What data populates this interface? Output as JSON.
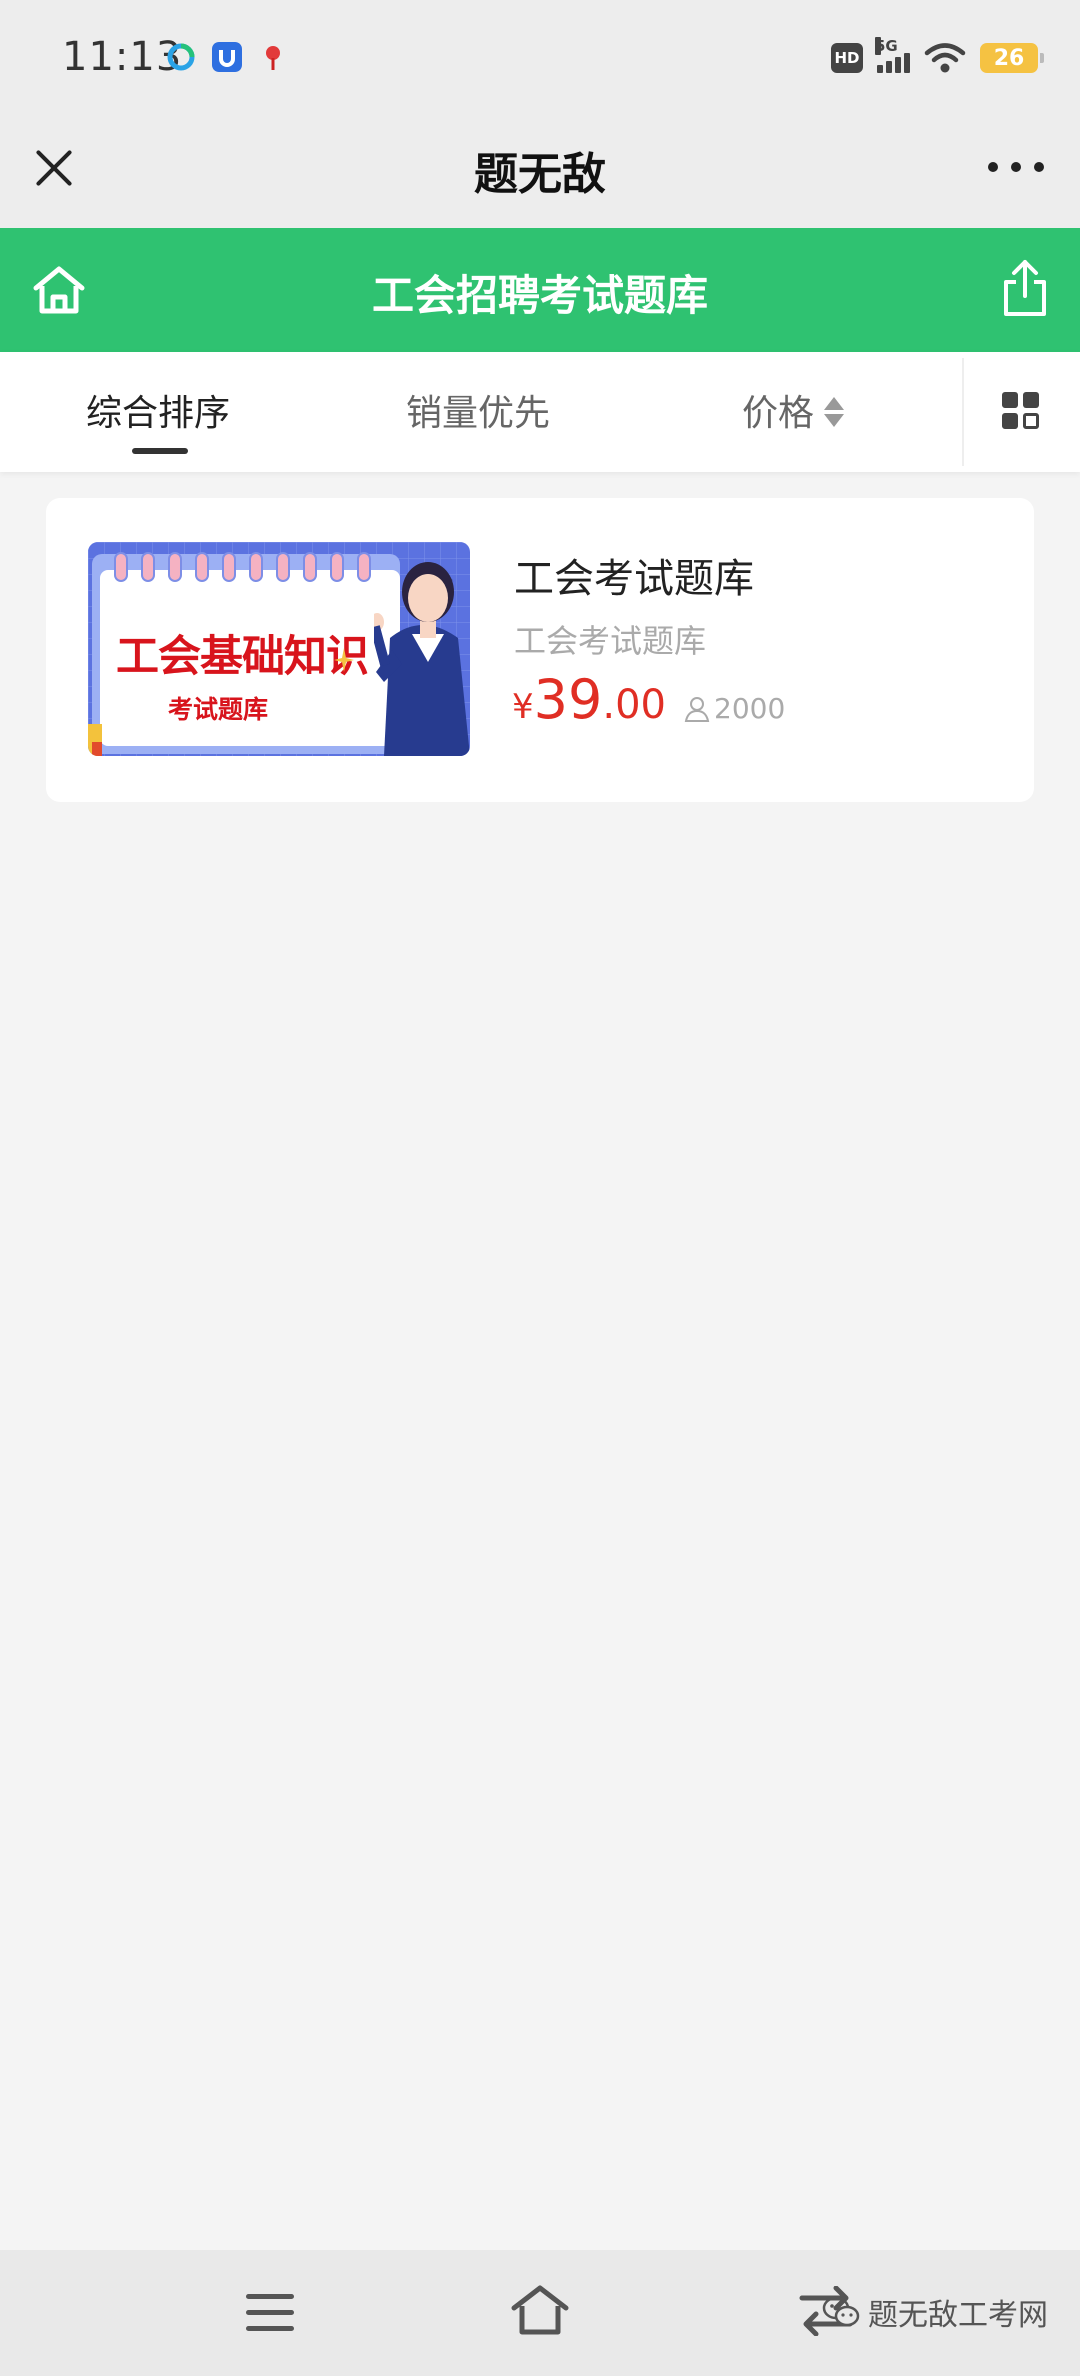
{
  "status_bar": {
    "time": "11:13",
    "hd": "HD",
    "network": "5G",
    "battery": "26"
  },
  "title_bar": {
    "title": "题无敌"
  },
  "header": {
    "title": "工会招聘考试题库"
  },
  "sort_tabs": {
    "items": [
      {
        "label": "综合排序",
        "active": true
      },
      {
        "label": "销量优先",
        "active": false
      },
      {
        "label": "价格",
        "active": false
      }
    ]
  },
  "products": [
    {
      "image_text_main": "工会基础知识",
      "image_text_sub": "考试题库",
      "title": "工会考试题库",
      "subtitle": "工会考试题库",
      "currency": "¥",
      "price_int": "39",
      "price_dec": ".00",
      "sales": "2000"
    }
  ],
  "watermark": {
    "text": "题无敌工考网"
  },
  "colors": {
    "header_green": "#2fc271",
    "price_red": "#e02e24",
    "banner_red": "#d8141c",
    "banner_blue": "#4a62d8"
  }
}
